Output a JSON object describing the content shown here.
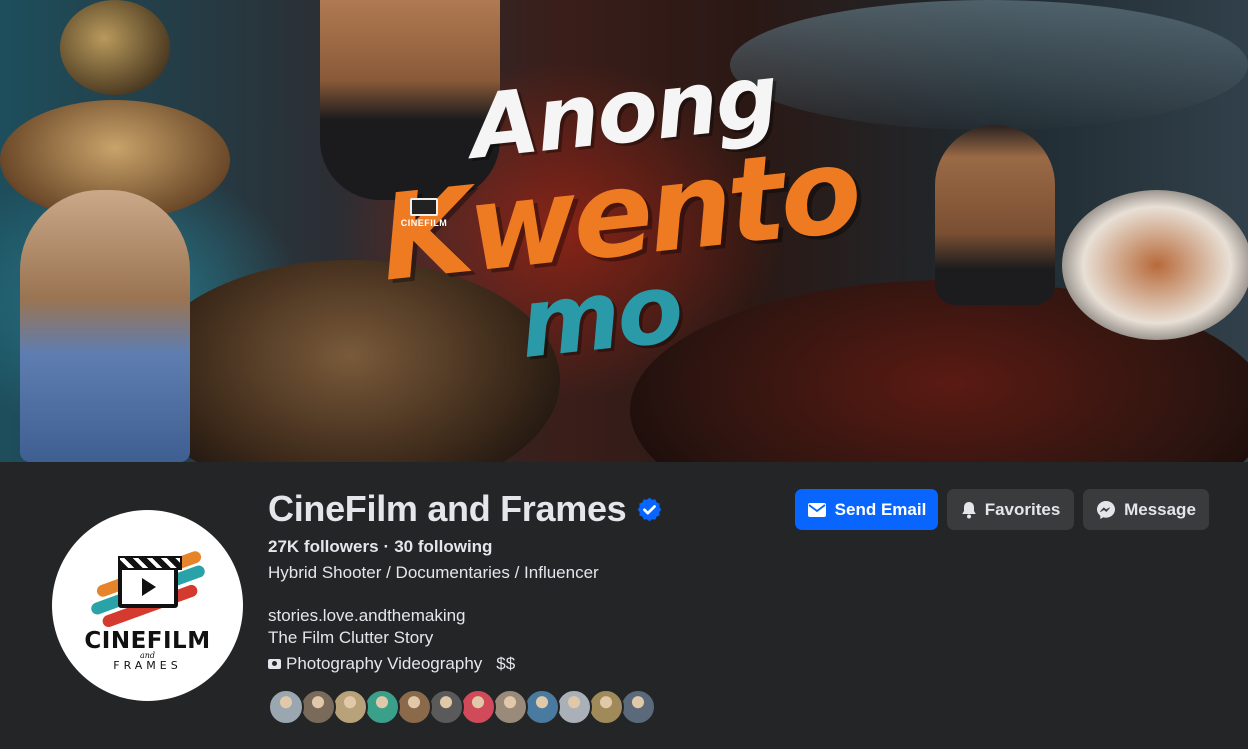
{
  "cover": {
    "title_line1": "Anong",
    "title_line2": "Kwento",
    "title_line3": "mo",
    "logo_text": "CINEFILM"
  },
  "profile": {
    "name": "CineFilm and Frames",
    "verified": true,
    "followers": "27K followers",
    "following": "30 following",
    "separator": "·",
    "category": "Hybrid Shooter / Documentaries / Influencer",
    "bio_line1": "stories.love.andthemaking",
    "bio_line2": "The Film Clutter Story",
    "services": "Photography Videography",
    "price_range": "$$",
    "avatar_logo": {
      "line1": "CINEFILM",
      "line2": "and",
      "line3": "FRAMES"
    }
  },
  "actions": {
    "send_email": "Send Email",
    "favorites": "Favorites",
    "message": "Message"
  },
  "colors": {
    "primary_button": "#0866ff",
    "secondary_button": "#3a3b3c",
    "background": "#242526",
    "verified_badge": "#0866ff",
    "title_orange": "#ee7a21",
    "title_teal": "#2a9aa8"
  },
  "mutual_friends": [
    {
      "color": "#9aa7b0"
    },
    {
      "color": "#7a6a5a"
    },
    {
      "color": "#b8a27a"
    },
    {
      "color": "#3aa08a"
    },
    {
      "color": "#8a6a4a"
    },
    {
      "color": "#5a5a5a"
    },
    {
      "color": "#d04a5a"
    },
    {
      "color": "#9a8a7a"
    },
    {
      "color": "#4a7aa0"
    },
    {
      "color": "#aab0b8"
    },
    {
      "color": "#a08a5a"
    },
    {
      "color": "#5a6a7a"
    }
  ]
}
